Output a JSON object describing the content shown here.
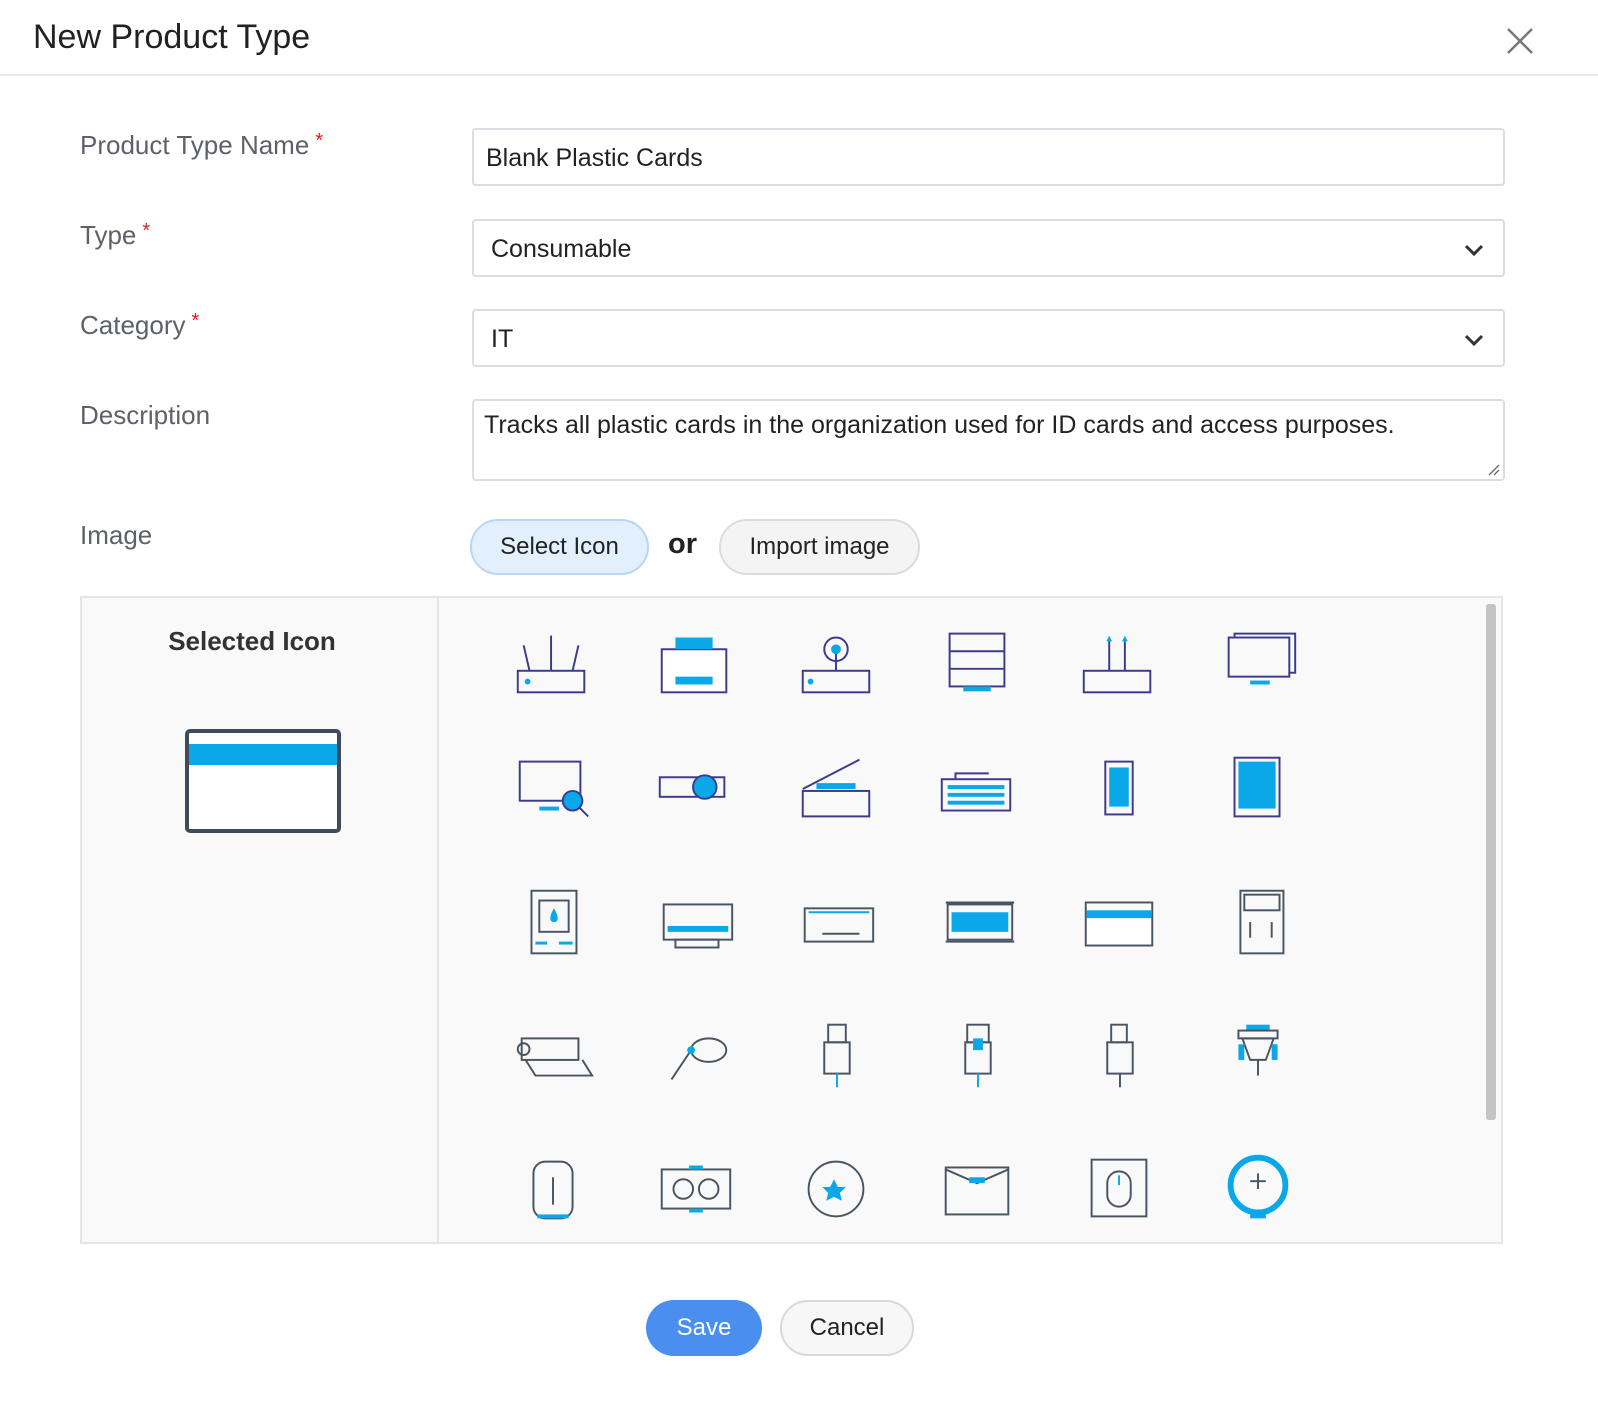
{
  "dialog": {
    "title": "New Product Type"
  },
  "form": {
    "name_label": "Product Type Name",
    "name_value": "Blank Plastic Cards",
    "type_label": "Type",
    "type_value": "Consumable",
    "category_label": "Category",
    "category_value": "IT",
    "description_label": "Description",
    "description_value": "Tracks all plastic cards in the organization used for ID cards and access purposes.",
    "image_label": "Image",
    "required_mark": "*"
  },
  "image": {
    "select_icon_label": "Select Icon",
    "or_label": "or",
    "import_label": "Import image",
    "selected_title": "Selected Icon",
    "selected_icon": "card-icon"
  },
  "icons": [
    "router",
    "printer",
    "wireless-access-point",
    "server",
    "network-switch",
    "monitors",
    "monitor-search",
    "projector",
    "scanner",
    "keyboard",
    "mobile-phone",
    "tablet",
    "ink-cartridge",
    "toner-cartridge",
    "ribbon-cartridge",
    "ram-module",
    "card",
    "keypad-device",
    "paper-roll",
    "cable-tie",
    "hdmi-connector",
    "ethernet-connector",
    "usb-connector",
    "vga-connector",
    "backpack",
    "graphics-card",
    "sticker",
    "envelope",
    "mouse",
    "headphones-stand"
  ],
  "actions": {
    "save_label": "Save",
    "cancel_label": "Cancel"
  },
  "colors": {
    "accent": "#0aa8e8",
    "navy": "#3d3a8c",
    "slate": "#4a5563",
    "save": "#4a8ef0",
    "select_bg": "#e2f0fd"
  }
}
